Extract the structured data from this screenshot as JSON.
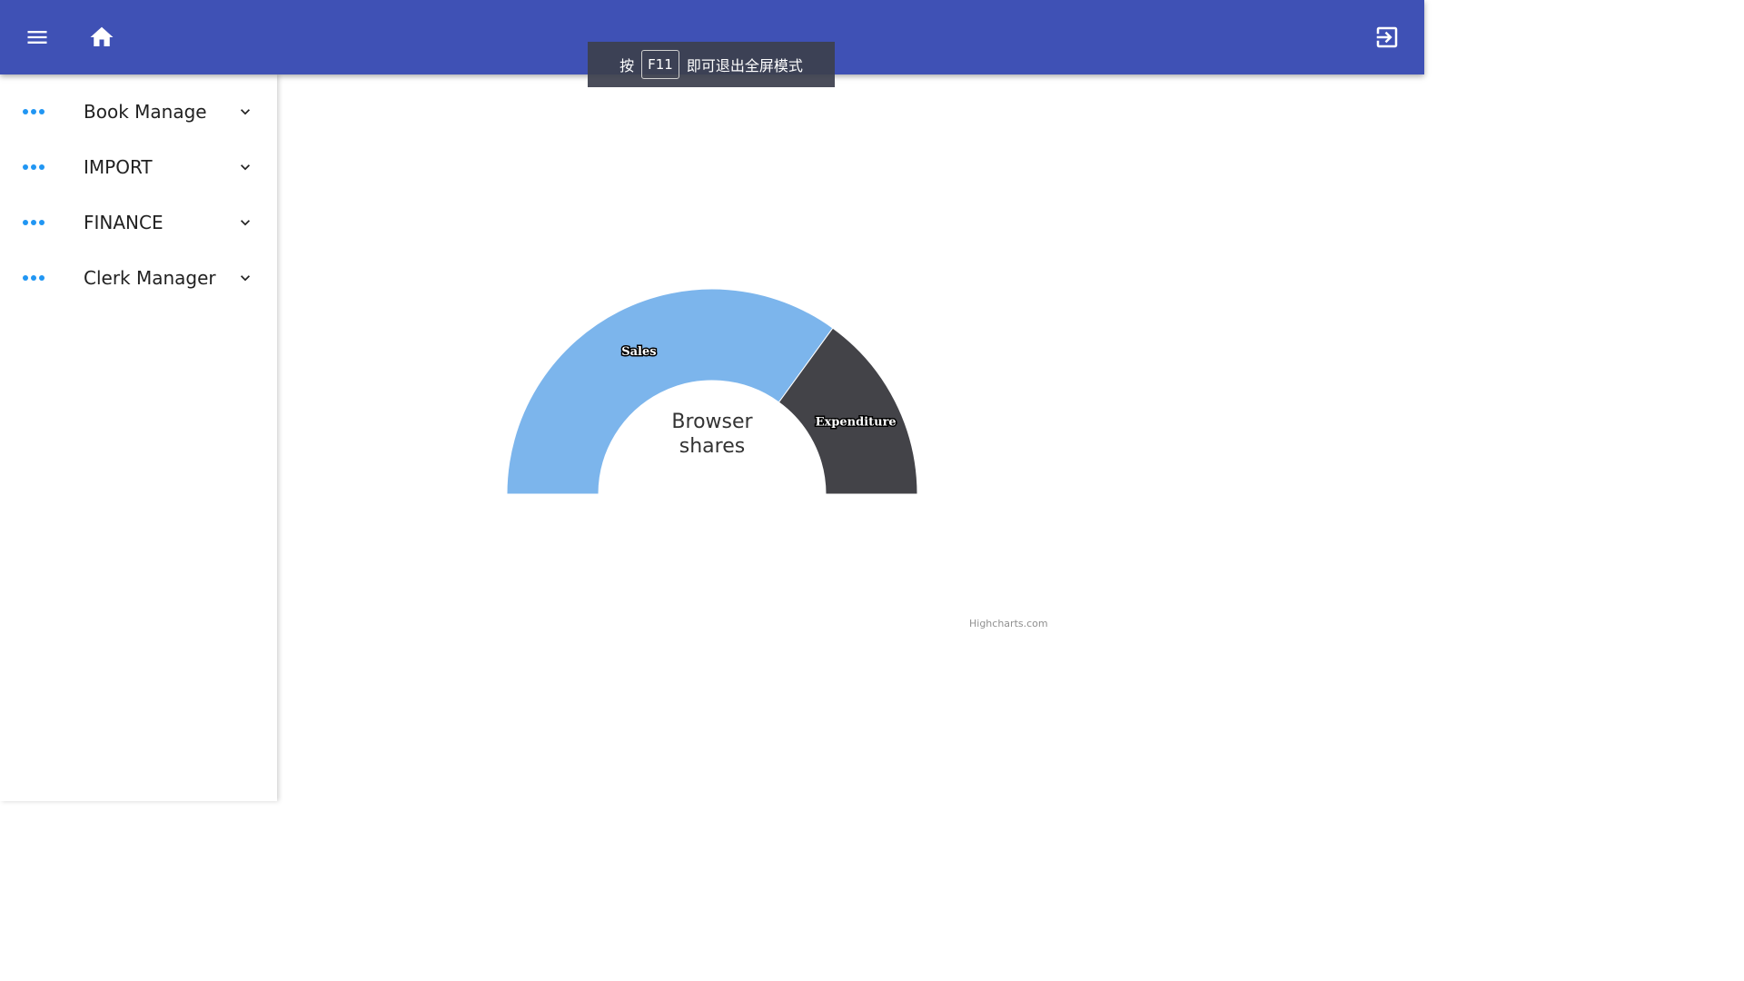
{
  "header": {
    "menu_icon": "menu-icon",
    "home_icon": "home-icon",
    "exit_icon": "exit-to-app-icon",
    "background": "#3f51b5"
  },
  "fullscreen_banner": {
    "prefix": "按",
    "key": "F11",
    "suffix": "即可退出全屏模式"
  },
  "sidebar": {
    "items": [
      {
        "label": "Book Manage",
        "icon": "more-horiz-icon",
        "chevron": "chevron-down-icon"
      },
      {
        "label": "IMPORT",
        "icon": "more-horiz-icon",
        "chevron": "chevron-down-icon"
      },
      {
        "label": "FINANCE",
        "icon": "more-horiz-icon",
        "chevron": "chevron-down-icon"
      },
      {
        "label": "Clerk Manager",
        "icon": "more-horiz-icon",
        "chevron": "chevron-down-icon"
      }
    ],
    "accent": "#2196f3"
  },
  "chart_data": {
    "type": "pie",
    "variant": "semi-donut",
    "title": "Browser shares",
    "title_lines": [
      "Browser",
      "shares"
    ],
    "series": [
      {
        "name": "Sales",
        "value": 70,
        "color": "#7cb5ec"
      },
      {
        "name": "Expenditure",
        "value": 30,
        "color": "#434348"
      }
    ],
    "credits": "Highcharts.com"
  }
}
